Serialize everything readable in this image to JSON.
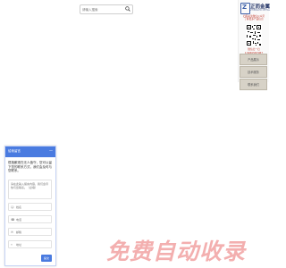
{
  "search": {
    "placeholder": "请输入搜索",
    "icon": "search-icon"
  },
  "sidebar": {
    "logo_mark": "Z",
    "brand_name": "正而金属",
    "brand_sub": "ZHENGER METAL",
    "contact_line1": "扫码关注微信公众号",
    "contact_line2": "了解更多产品信息",
    "qr_caption": "微信扫一扫",
    "phone": "13480587087"
  },
  "sidenav": {
    "items": [
      "产品展示",
      "技术服务",
      "联系我们"
    ]
  },
  "chat_panel": {
    "title": "给我留言",
    "close": "—",
    "message": "很抱歉现在无人值守，您可以留下您的联系方式，我们会及时与您联系。",
    "textarea_placeholder": "请在此输入留言内容，我们会尽快与您联系。（必填）",
    "fields": [
      {
        "icon": "user-icon",
        "glyph": "☺",
        "placeholder": "姓名"
      },
      {
        "icon": "phone-icon",
        "glyph": "☎",
        "placeholder": "电话"
      },
      {
        "icon": "email-icon",
        "glyph": "✉",
        "placeholder": "邮箱"
      },
      {
        "icon": "location-icon",
        "glyph": "⌖",
        "placeholder": "地址"
      }
    ],
    "submit": "提交"
  },
  "watermark": "免费自动收录",
  "colors": {
    "accent": "#4a7be0",
    "sidenav_bg": "#d7d2c7",
    "watermark": "#f2a7a7",
    "contact_red": "#c0392b"
  }
}
